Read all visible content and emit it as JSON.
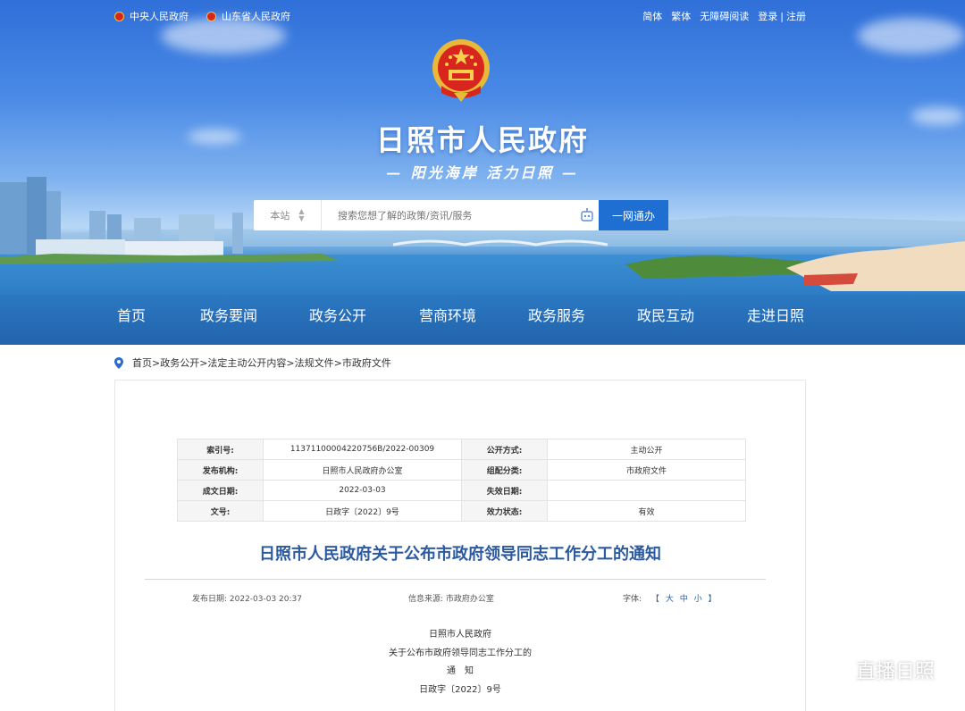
{
  "top_links_left": [
    {
      "label": "中央人民政府"
    },
    {
      "label": "山东省人民政府"
    }
  ],
  "top_links_right": {
    "simplified": "简体",
    "traditional": "繁体",
    "accessible": "无障碍阅读",
    "login": "登录",
    "separator": "|",
    "register": "注册"
  },
  "site": {
    "title": "日照市人民政府",
    "slogan": "— 阳光海岸  活力日照 —"
  },
  "search": {
    "scope": "本站",
    "placeholder": "搜索您想了解的政策/资讯/服务",
    "button": "一网通办"
  },
  "nav": [
    "首页",
    "政务要闻",
    "政务公开",
    "营商环境",
    "政务服务",
    "政民互动",
    "走进日照"
  ],
  "breadcrumb": "首页>政务公开>法定主动公开内容>法规文件>市政府文件",
  "meta": {
    "rows": [
      [
        "索引号:",
        "11371100004220756B/2022-00309",
        "公开方式:",
        "主动公开"
      ],
      [
        "发布机构:",
        "日照市人民政府办公室",
        "组配分类:",
        "市政府文件"
      ],
      [
        "成文日期:",
        "2022-03-03",
        "失效日期:",
        ""
      ],
      [
        "文号:",
        "日政字〔2022〕9号",
        "效力状态:",
        "有效"
      ]
    ]
  },
  "article": {
    "title": "日照市人民政府关于公布市政府领导同志工作分工的通知",
    "publish_date": "发布日期:   2022-03-03 20:37",
    "source": "信息来源:   市政府办公室",
    "font_label": "字体:",
    "font_open": "【",
    "font_large": "大",
    "font_medium": "中",
    "font_small": "小",
    "font_close": "】",
    "body": [
      "日照市人民政府",
      "关于公布市政府领导同志工作分工的",
      "通　知",
      "日政字〔2022〕9号"
    ]
  },
  "watermark": "直播日照",
  "colors": {
    "accent": "#1f6fd3",
    "title_blue": "#2c5aa0"
  }
}
